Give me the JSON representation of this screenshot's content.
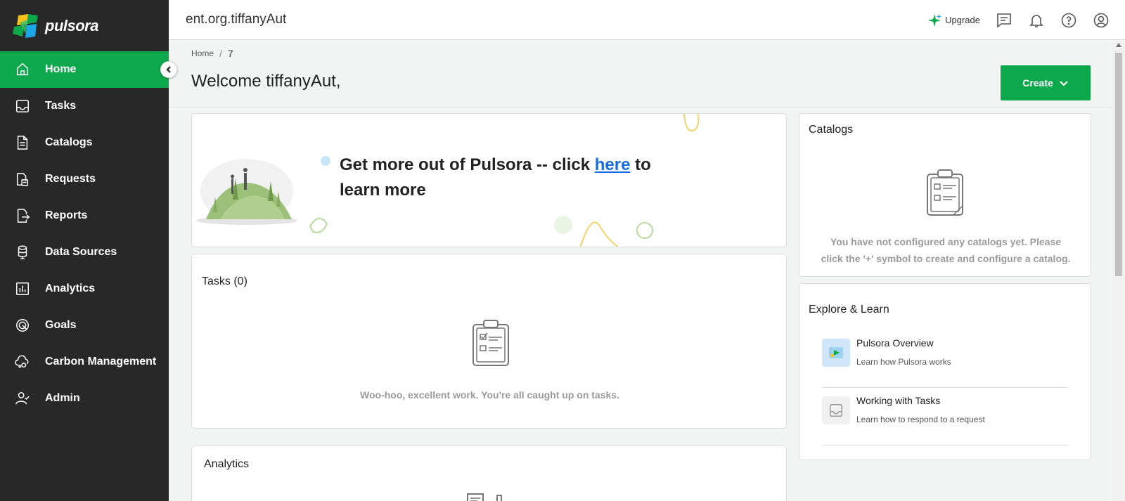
{
  "brand": {
    "name": "pulsora"
  },
  "sidebar": {
    "items": [
      {
        "label": "Home",
        "icon": "home-icon",
        "active": true
      },
      {
        "label": "Tasks",
        "icon": "inbox-icon"
      },
      {
        "label": "Catalogs",
        "icon": "document-icon"
      },
      {
        "label": "Requests",
        "icon": "requests-icon"
      },
      {
        "label": "Reports",
        "icon": "reports-icon"
      },
      {
        "label": "Data Sources",
        "icon": "database-icon"
      },
      {
        "label": "Analytics",
        "icon": "bar-chart-icon"
      },
      {
        "label": "Goals",
        "icon": "target-icon"
      },
      {
        "label": "Carbon Management",
        "icon": "cloud-gear-icon"
      },
      {
        "label": "Admin",
        "icon": "user-check-icon"
      }
    ]
  },
  "header": {
    "org": "ent.org.tiffanyAut",
    "upgrade_label": "Upgrade"
  },
  "breadcrumb": {
    "home": "Home",
    "separator": "/",
    "current": "7"
  },
  "page": {
    "welcome": "Welcome tiffanyAut,",
    "create_label": "Create"
  },
  "banner": {
    "text_before": "Get more out of Pulsora -- click ",
    "link": "here",
    "text_after": " to learn more"
  },
  "tasks": {
    "title": "Tasks (0)",
    "empty": "Woo-hoo, excellent work. You're all caught up on tasks."
  },
  "analytics": {
    "title": "Analytics"
  },
  "catalogs": {
    "title": "Catalogs",
    "empty": "You have not configured any catalogs yet. Please click the '+' symbol to create and configure a catalog."
  },
  "explore": {
    "title": "Explore & Learn",
    "items": [
      {
        "title": "Pulsora Overview",
        "subtitle": "Learn how Pulsora works"
      },
      {
        "title": "Working with Tasks",
        "subtitle": "Learn how to respond to a request"
      }
    ]
  },
  "colors": {
    "accent": "#0ea84c",
    "sidebar": "#282828",
    "link": "#1a6de0"
  }
}
